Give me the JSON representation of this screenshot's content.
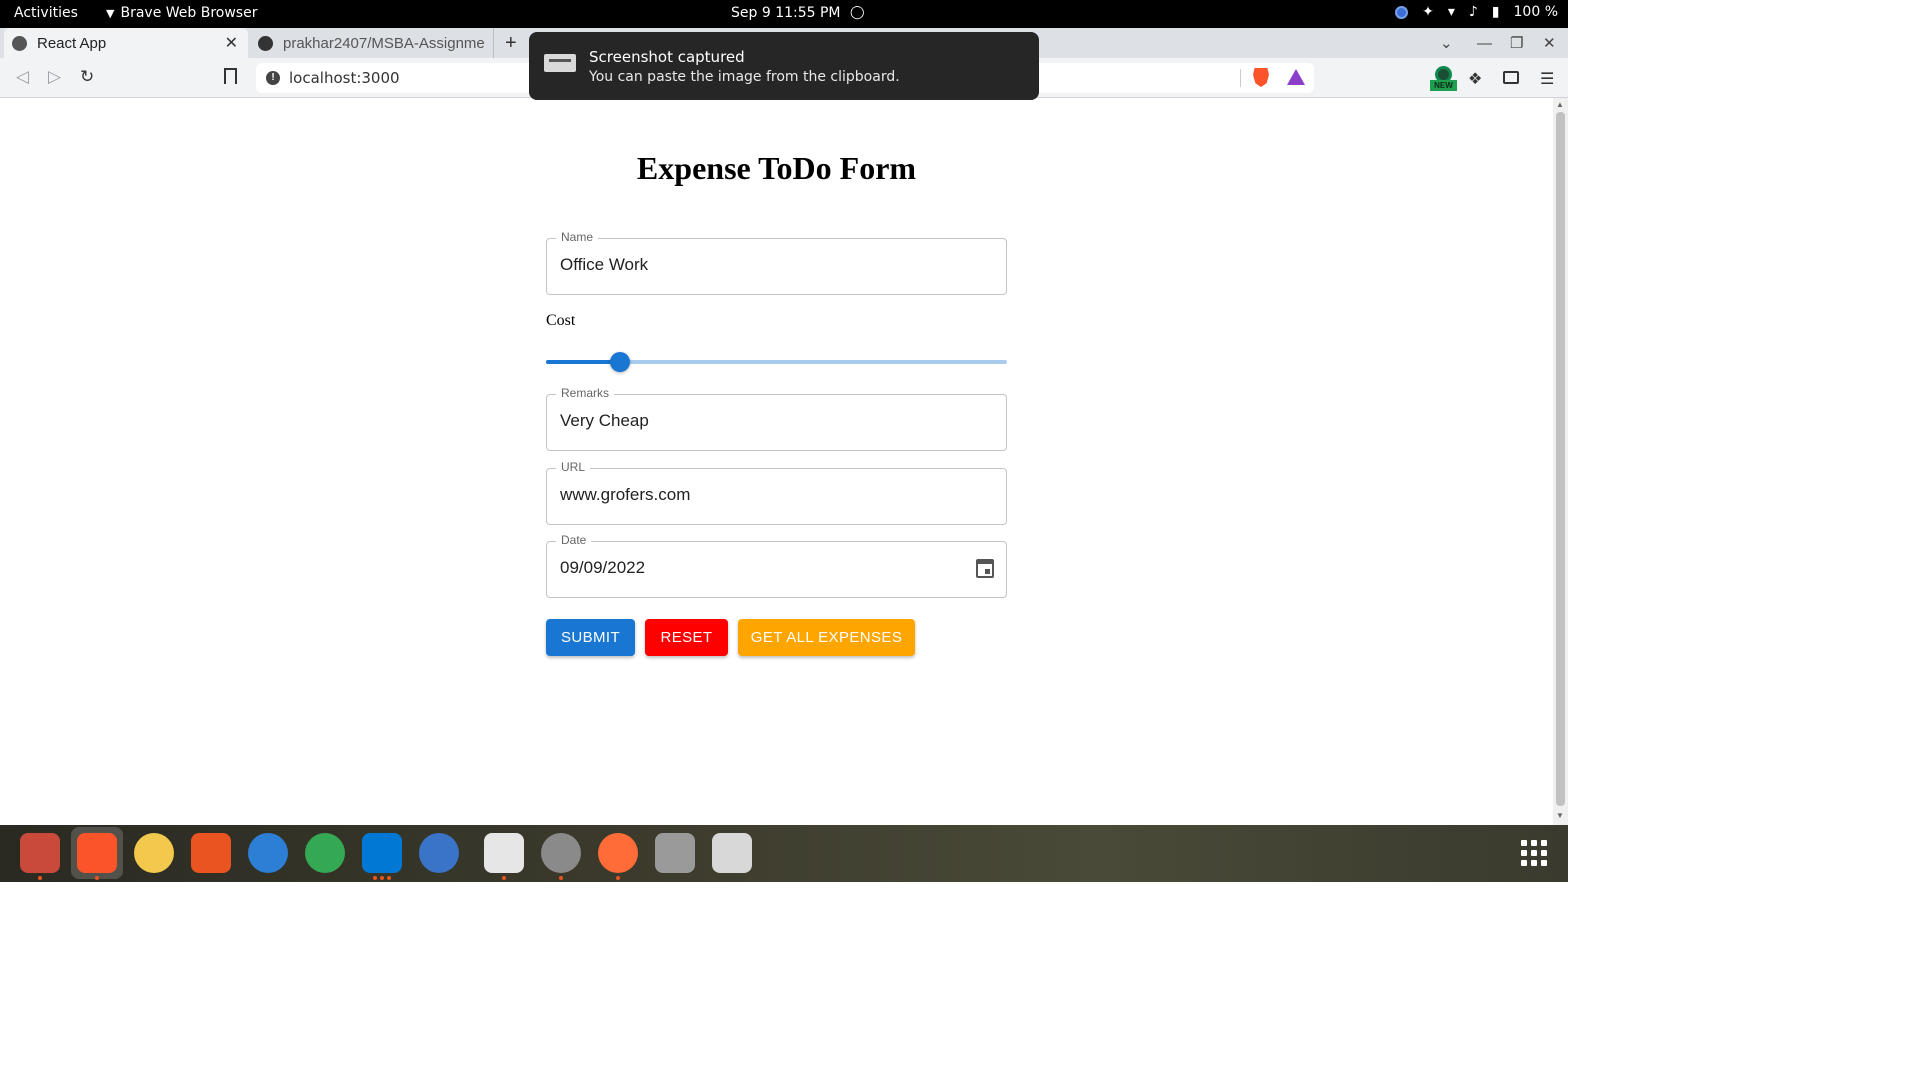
{
  "topbar": {
    "activities": "Activities",
    "app_name": "Brave Web Browser",
    "clock": "Sep 9  11:55 PM",
    "battery": "100 %"
  },
  "browser": {
    "tabs": [
      {
        "title": "React App",
        "active": true
      },
      {
        "title": "prakhar2407/MSBA-Assignme",
        "active": false
      }
    ],
    "url": "localhost:3000"
  },
  "notification": {
    "title": "Screenshot captured",
    "body": "You can paste the image from the clipboard."
  },
  "form": {
    "title": "Expense ToDo Form",
    "name": {
      "label": "Name",
      "value": "Office Work"
    },
    "cost": {
      "label": "Cost",
      "slider_fraction": 0.16
    },
    "remarks": {
      "label": "Remarks",
      "value": "Very Cheap"
    },
    "url": {
      "label": "URL",
      "value": "www.grofers.com"
    },
    "date": {
      "label": "Date",
      "value": "09/09/2022"
    },
    "buttons": {
      "submit": "SUBMIT",
      "reset": "RESET",
      "get_all": "GET ALL EXPENSES"
    }
  },
  "colors": {
    "primary": "#1976d2",
    "reset": "#ff0000",
    "get_all": "#ffa500",
    "ubuntu_orange": "#e95420"
  },
  "dock": {
    "apps": [
      {
        "name": "files",
        "color": "#c94a3a"
      },
      {
        "name": "brave",
        "color": "#fb542b"
      },
      {
        "name": "rhythmbox",
        "color": "#f2c94c"
      },
      {
        "name": "app-center",
        "color": "#e95420"
      },
      {
        "name": "help",
        "color": "#2d7fd6"
      },
      {
        "name": "chrome",
        "color": "#34a853"
      },
      {
        "name": "vscode",
        "color": "#0078d4"
      },
      {
        "name": "qbittorrent",
        "color": "#3a74c9"
      },
      {
        "name": "gimp",
        "color": "#e6e6e6"
      },
      {
        "name": "optical-drive",
        "color": "#8a8a8a"
      },
      {
        "name": "postman",
        "color": "#ff6c37"
      },
      {
        "name": "disk-utility",
        "color": "#9a9a9a"
      },
      {
        "name": "trash",
        "color": "#d8d8d8"
      }
    ]
  }
}
